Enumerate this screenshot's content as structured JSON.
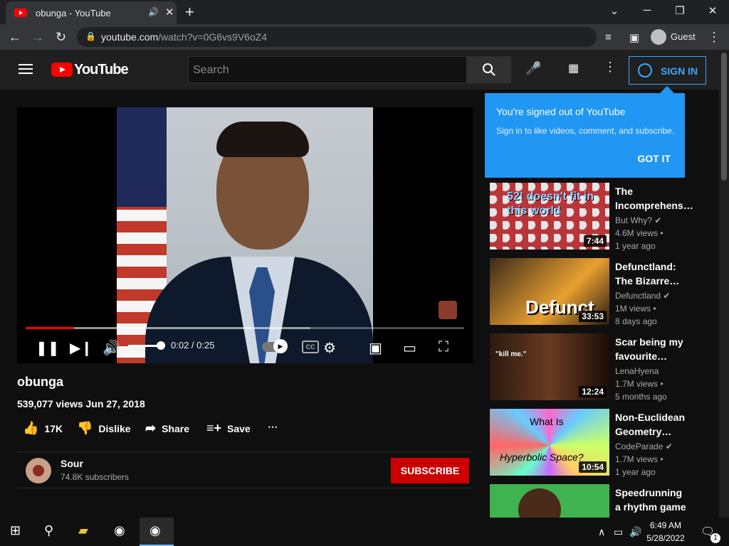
{
  "browser": {
    "tab_title": "obunga - YouTube",
    "tab_audio_icon": "🔊",
    "tab_close": "✕",
    "new_tab": "+",
    "url_host": "youtube.com",
    "url_path": "/watch?v=0G6vs9V6oZ4",
    "profile_label": "Guest",
    "win_min": "─",
    "win_max": "❐",
    "win_close": "✕",
    "chevron": "⌄"
  },
  "header": {
    "wordmark": "YouTube",
    "search_placeholder": "Search",
    "sign_in": "SIGN IN"
  },
  "tooltip": {
    "title": "You're signed out of YouTube",
    "body": "Sign in to like videos, comment, and subscribe.",
    "button": "GOT IT"
  },
  "player": {
    "time": "0:02 / 0:25",
    "progress_fraction": 0.11,
    "volume_fraction": 1.0,
    "cc_label": "CC"
  },
  "video": {
    "title": "obunga",
    "meta": "539,077 views  Jun 27, 2018",
    "likes": "17K",
    "dislike_label": "Dislike",
    "share_label": "Share",
    "save_label": "Save"
  },
  "channel": {
    "name": "Sour",
    "subscribers": "74.8K subscribers",
    "subscribe_label": "SUBSCRIBE"
  },
  "recommendations": [
    {
      "title": "The Incomprehens…",
      "channel": "But Why?",
      "views": "4.6M views •",
      "age": "1 year ago",
      "duration": "7:44",
      "thumb_text": "52! doesn't fit in this world"
    },
    {
      "title": "Defunctland: The Bizarre…",
      "channel": "Defunctland",
      "views": "1M views •",
      "age": "8 days ago",
      "duration": "33:53",
      "thumb_text": "Defunct"
    },
    {
      "title": "Scar being my favourite…",
      "channel": "LenaHyena",
      "views": "1.7M views •",
      "age": "5 months ago",
      "duration": "12:24",
      "thumb_text": "\"kill me.\""
    },
    {
      "title": "Non-Euclidean Geometry…",
      "channel": "CodeParade",
      "views": "1.7M views •",
      "age": "1 year ago",
      "duration": "10:54",
      "thumb_text_1": "What Is",
      "thumb_text_2": "Hyperbolic Space?"
    },
    {
      "title": "Speedrunning a rhythm game i…"
    }
  ],
  "taskbar": {
    "time": "6:49 AM",
    "date": "5/28/2022",
    "notification_count": "1"
  },
  "colors": {
    "accent": "#3ea6ff",
    "subscribe": "#cc0000",
    "tooltip": "#2196f3",
    "progress": "#ff0000"
  }
}
